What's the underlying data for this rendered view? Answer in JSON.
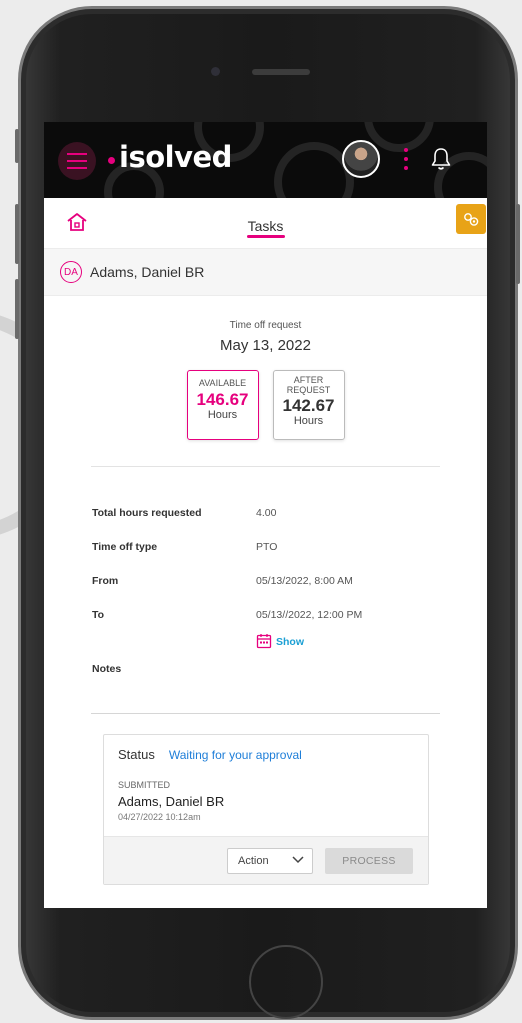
{
  "app": {
    "brand": "isolved"
  },
  "nav": {
    "title": "Tasks"
  },
  "employee": {
    "initials": "DA",
    "name": "Adams, Daniel BR"
  },
  "request": {
    "type_label": "Time off request",
    "date": "May 13, 2022",
    "available": {
      "label": "AVAILABLE",
      "value": "146.67",
      "unit": "Hours"
    },
    "after_request": {
      "label_line1": "AFTER",
      "label_line2": "REQUEST",
      "value": "142.67",
      "unit": "Hours"
    }
  },
  "details": [
    {
      "key": "Total hours requested",
      "value": "4.00"
    },
    {
      "key": "Time off type",
      "value": "PTO"
    },
    {
      "key": "From",
      "value": "05/13/2022, 8:00 AM"
    },
    {
      "key": "To",
      "value": "05/13//2022, 12:00 PM"
    }
  ],
  "show_link": "Show",
  "notes_label": "Notes",
  "status": {
    "title": "Status",
    "value": "Waiting for your approval",
    "submitted_label": "SUBMITTED",
    "submitted_by": "Adams, Daniel BR",
    "submitted_at": "04/27/2022 10:12am",
    "action_selected": "Action",
    "process_label": "PROCESS"
  },
  "colors": {
    "accent": "#e6007e",
    "link": "#1a9fd4",
    "badge": "#e8a317",
    "appbar": "#0b0b0b"
  },
  "icons": [
    "hamburger-menu-icon",
    "kebab-menu-icon",
    "bell-icon",
    "home-icon",
    "settings-badge-icon",
    "calendar-icon",
    "chevron-down-icon"
  ]
}
